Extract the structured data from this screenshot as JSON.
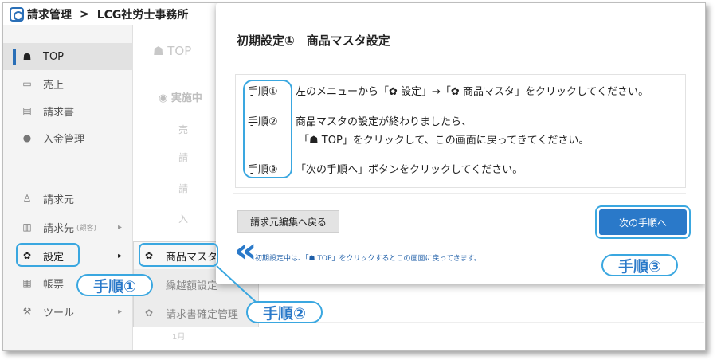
{
  "header": {
    "app_name": "請求管理",
    "separator": ">",
    "org_name": "LCG社労士事務所"
  },
  "sidebar": {
    "items": [
      {
        "label": "TOP",
        "icon": "home-icon"
      },
      {
        "label": "売上",
        "icon": "card-icon"
      },
      {
        "label": "請求書",
        "icon": "document-icon"
      },
      {
        "label": "入金管理",
        "icon": "check-circle-icon"
      },
      {
        "label": "請求元",
        "icon": "user-icon"
      },
      {
        "label": "請求先",
        "sub": "(顧客)",
        "icon": "building-icon"
      },
      {
        "label": "設定",
        "icon": "gear-icon"
      },
      {
        "label": "帳票",
        "icon": "table-icon"
      },
      {
        "label": "ツール",
        "icon": "wrench-icon"
      }
    ]
  },
  "submenu": {
    "items": [
      {
        "label": "商品マスタ",
        "icon": "gear-icon"
      },
      {
        "label": "繰越額設定"
      },
      {
        "label": "請求書確定管理",
        "icon": "gear-icon"
      }
    ]
  },
  "background": {
    "top_label": "TOP",
    "status_label": "実施中",
    "fragments": [
      "売",
      "請",
      "請",
      "入"
    ],
    "month": "1月"
  },
  "modal": {
    "title": "初期設定①　商品マスタ設定",
    "steps": [
      {
        "label": "手順①",
        "text": "左のメニューから「✿ 設定」→「✿ 商品マスタ」をクリックしてください。"
      },
      {
        "label": "手順②",
        "text": "商品マスタの設定が終わりましたら、",
        "text2": "「☗ TOP」をクリックして、この画面に戻ってきてください。"
      },
      {
        "label": "手順③",
        "text": "「次の手順へ」ボタンをクリックしてください。"
      }
    ],
    "back_button": "請求元編集へ戻る",
    "next_button": "次の手順へ",
    "note": "初期設定中は、「☗ TOP」をクリックするとこの画面に戻ってきます。"
  },
  "callouts": {
    "step1": "手順①",
    "step2": "手順②",
    "step3": "手順③"
  },
  "colors": {
    "accent": "#2a79c9",
    "callout_border": "#3aa7e0"
  }
}
